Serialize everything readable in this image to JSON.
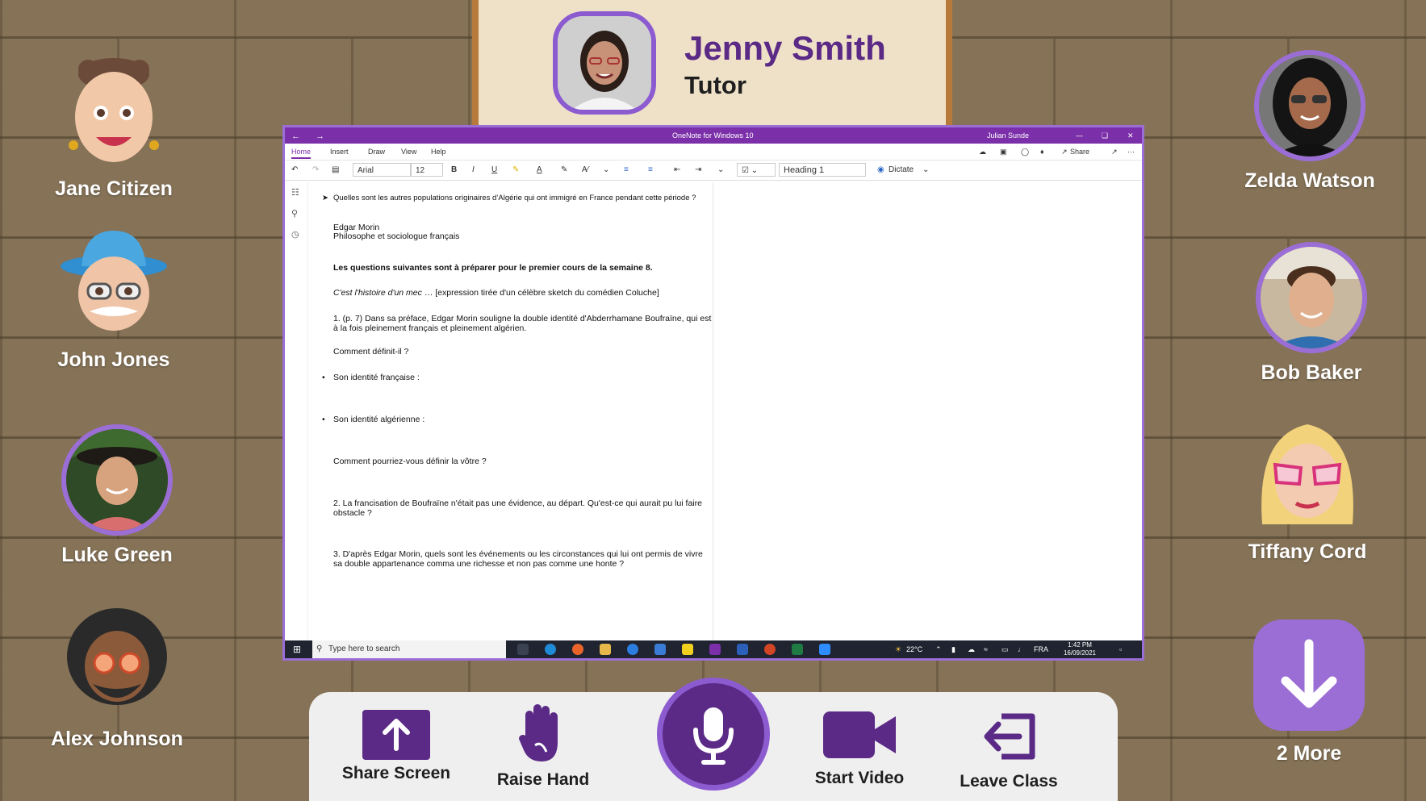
{
  "tutor": {
    "name": "Jenny Smith",
    "role": "Tutor"
  },
  "participants_left": [
    {
      "name": "Jane Citizen"
    },
    {
      "name": "John Jones"
    },
    {
      "name": "Luke Green"
    },
    {
      "name": "Alex Johnson"
    }
  ],
  "participants_right": [
    {
      "name": "Zelda Watson"
    },
    {
      "name": "Bob Baker"
    },
    {
      "name": "Tiffany Cord"
    }
  ],
  "more_button": {
    "label": "2 More"
  },
  "controls": {
    "share_screen": "Share Screen",
    "raise_hand": "Raise Hand",
    "start_video": "Start Video",
    "leave_class": "Leave Class"
  },
  "onenote": {
    "title": "OneNote for Windows 10",
    "user": "Julian Sunde",
    "menu": [
      "Home",
      "Insert",
      "Draw",
      "View",
      "Help"
    ],
    "share_label": "Share",
    "font": "Arial",
    "font_size": "12",
    "style": "Heading 1",
    "dictate": "Dictate",
    "content": {
      "q0": "Quelles sont les autres populations originaires d’Algérie qui ont immigré en France pendant cette période ?",
      "author": "Edgar Morin",
      "author_role": "Philosophe et sociologue français",
      "instruction": "Les questions suivantes sont à préparer pour le premier cours de la semaine 8.",
      "quote_italic": "C'est l'histoire d'un mec",
      "quote_rest": " … [expression tirée d'un célèbre sketch du comédien Coluche]",
      "q1": "1. (p. 7) Dans sa préface, Edgar Morin souligne la double identité d'Abderrhamane Boufraïne, qui est à la fois pleinement français et pleinement algérien.",
      "q1a": "Comment définit-il ?",
      "bullet1": "Son identité française :",
      "bullet2": "Son identité algérienne :",
      "q1b": "Comment pourriez-vous définir la vôtre ?",
      "q2": "2. La francisation de Boufraïne n'était pas une évidence, au départ. Qu'est-ce qui aurait pu lui faire obstacle ?",
      "q3": "3. D'après Edgar Morin, quels sont les événements ou les circonstances qui lui ont permis de vivre sa double appartenance comma une richesse et non pas comme une honte ?"
    },
    "taskbar": {
      "search_placeholder": "Type here to search",
      "weather": "22°C",
      "lang": "FRA",
      "time": "1:42 PM",
      "date": "16/09/2021"
    }
  },
  "colors": {
    "purple_dark": "#5b2a86",
    "purple_light": "#9b6ed6",
    "background": "#857257"
  }
}
